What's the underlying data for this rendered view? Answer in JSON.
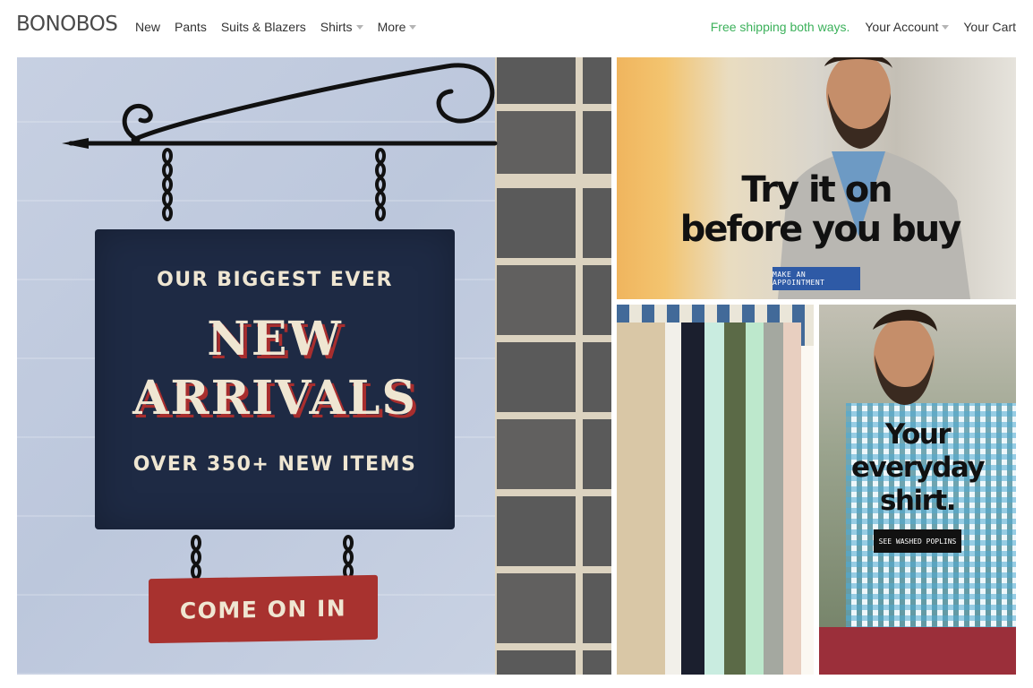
{
  "brand": {
    "name": "BONOBOS"
  },
  "nav": {
    "left": [
      {
        "label": "New",
        "has_caret": false
      },
      {
        "label": "Pants",
        "has_caret": false
      },
      {
        "label": "Suits & Blazers",
        "has_caret": false
      },
      {
        "label": "Shirts",
        "has_caret": true
      },
      {
        "label": "More",
        "has_caret": true
      }
    ],
    "right": {
      "promo": "Free shipping both ways.",
      "account": "Your Account",
      "cart": "Your Cart"
    }
  },
  "hero": {
    "line1": "OUR BIGGEST EVER",
    "headline1": "NEW",
    "headline2": "ARRIVALS",
    "line4": "OVER 350+ NEW ITEMS",
    "cta": "COME ON IN"
  },
  "tryon": {
    "line1": "Try it on",
    "line2": "before you buy",
    "button": "MAKE AN APPOINTMENT"
  },
  "shirt": {
    "line1": "Your",
    "line2": "everyday",
    "line3": "shirt.",
    "button": "SEE WASHED POPLINS"
  },
  "colors": {
    "promo_green": "#3cb15b",
    "sign_navy": "#1e2a44",
    "sign_red": "#a8322f",
    "appointment_blue": "#2e5aa6"
  }
}
